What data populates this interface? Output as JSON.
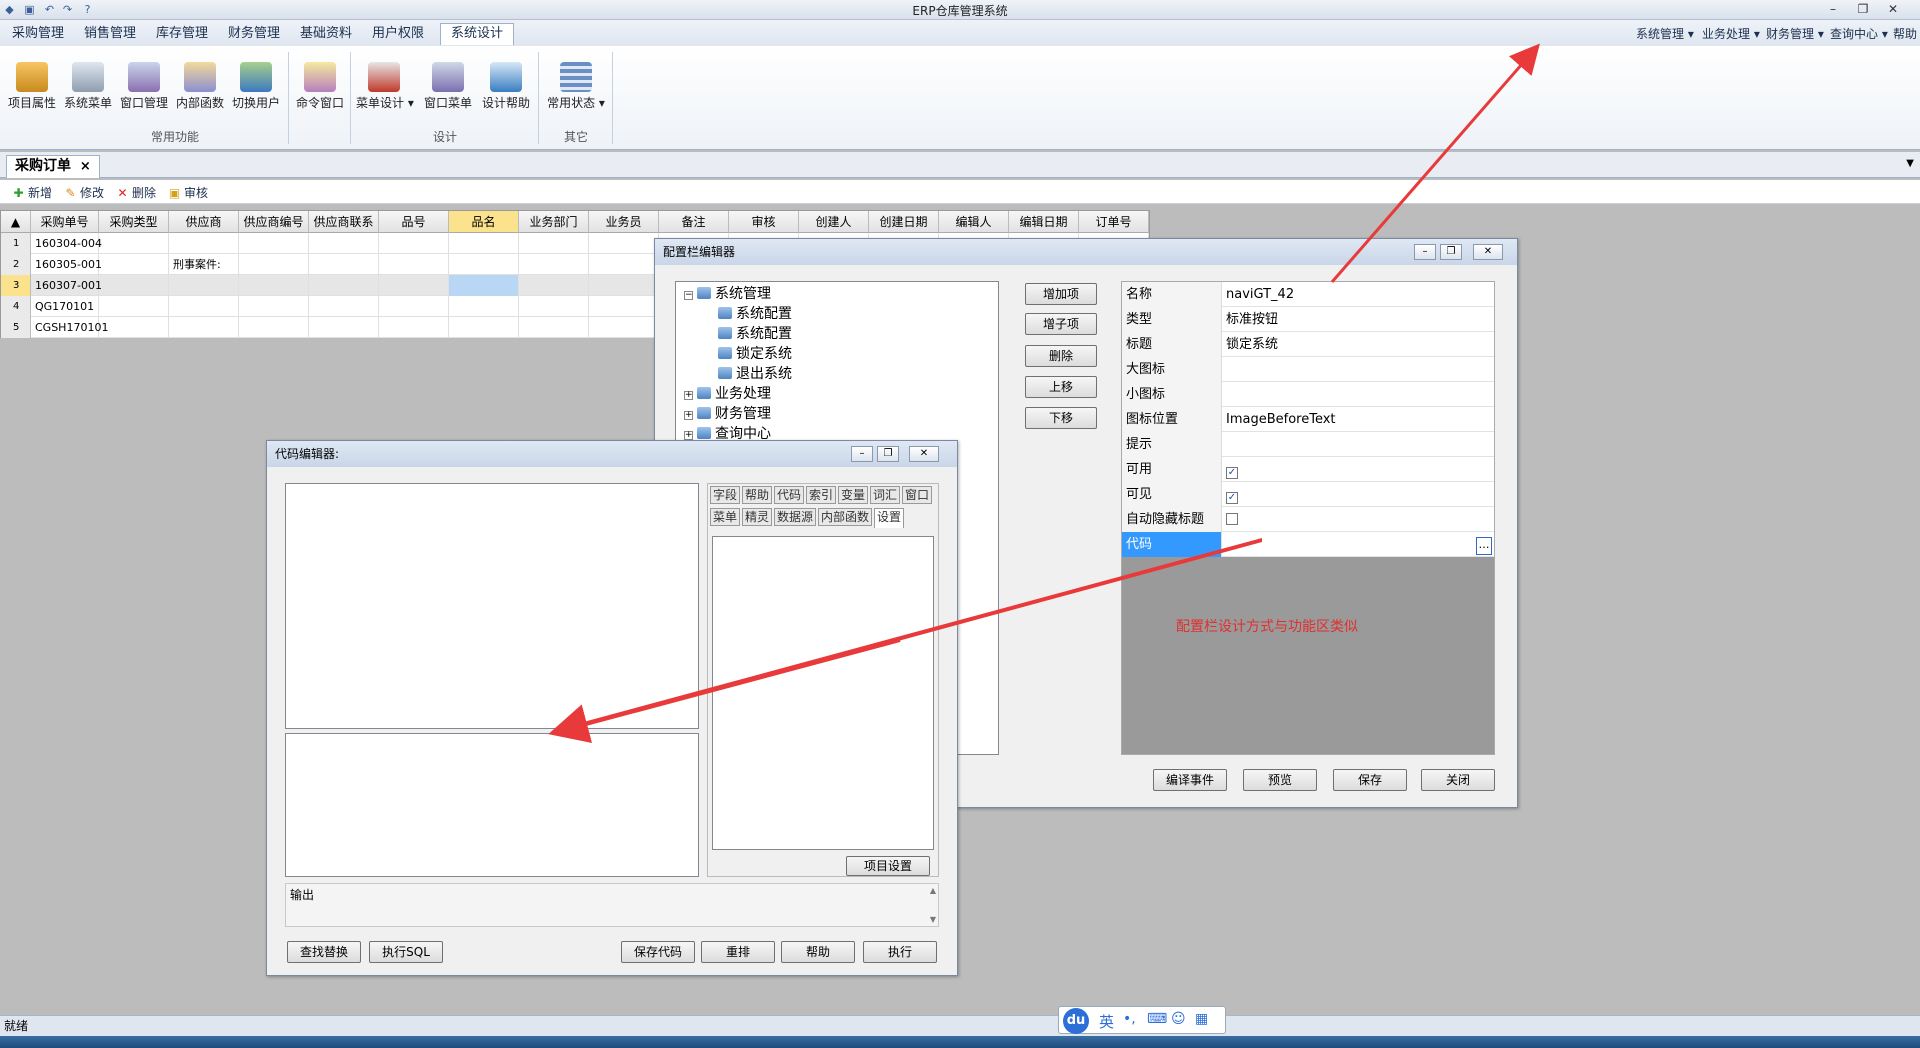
{
  "window": {
    "title": "ERP仓库管理系统"
  },
  "menu": {
    "tabs": [
      "采购管理",
      "销售管理",
      "库存管理",
      "财务管理",
      "基础资料",
      "用户权限",
      "系统设计"
    ],
    "active": "系统设计",
    "right": [
      "系统管理 ▾",
      "业务处理 ▾",
      "财务管理 ▾",
      "查询中心 ▾",
      "帮助"
    ]
  },
  "ribbon": {
    "buttons": [
      "项目属性",
      "系统菜单",
      "窗口管理",
      "内部函数",
      "切换用户",
      "命令窗口",
      "菜单设计 ▾",
      "窗口菜单",
      "设计帮助",
      "常用状态 ▾"
    ],
    "groups": [
      "常用功能",
      "设计",
      "其它"
    ]
  },
  "doc_tab": {
    "label": "采购订单",
    "close": "×"
  },
  "toolbar": {
    "new": "新增",
    "edit": "修改",
    "delete": "删除",
    "audit": "审核"
  },
  "grid": {
    "headers": [
      "采购单号",
      "采购类型",
      "供应商",
      "供应商编号",
      "供应商联系",
      "品号",
      "品名",
      "业务部门",
      "业务员",
      "备注",
      "审核",
      "创建人",
      "创建日期",
      "编辑人",
      "编辑日期",
      "订单号"
    ],
    "rows": [
      {
        "no": "1",
        "order": "160304-004",
        "extra": ""
      },
      {
        "no": "2",
        "order": "160305-001",
        "extra": "刑事案件:"
      },
      {
        "no": "3",
        "order": "160307-001",
        "extra": ""
      },
      {
        "no": "4",
        "order": "QG170101",
        "extra": ""
      },
      {
        "no": "5",
        "order": "CGSH170101",
        "extra": ""
      }
    ]
  },
  "config_dialog": {
    "title": "配置栏编辑器",
    "tree": [
      "系统管理",
      "系统配置",
      "系统配置",
      "锁定系统",
      "退出系统",
      "业务处理",
      "财务管理",
      "查询中心"
    ],
    "buttons": [
      "增加项",
      "增子项",
      "删除",
      "上移",
      "下移"
    ],
    "props": [
      {
        "k": "名称",
        "v": "naviGT_42"
      },
      {
        "k": "类型",
        "v": "标准按钮"
      },
      {
        "k": "标题",
        "v": "锁定系统"
      },
      {
        "k": "大图标",
        "v": ""
      },
      {
        "k": "小图标",
        "v": ""
      },
      {
        "k": "图标位置",
        "v": "ImageBeforeText"
      },
      {
        "k": "提示",
        "v": ""
      },
      {
        "k": "可用",
        "v": "✓"
      },
      {
        "k": "可见",
        "v": "✓"
      },
      {
        "k": "自动隐藏标题",
        "v": ""
      },
      {
        "k": "代码",
        "v": "…"
      }
    ],
    "annotation": "配置栏设计方式与功能区类似",
    "footer": [
      "编译事件",
      "预览",
      "保存",
      "关闭"
    ]
  },
  "code_dialog": {
    "title": "代码编辑器:",
    "tabs_row1": [
      "字段",
      "帮助",
      "代码",
      "索引",
      "变量",
      "词汇",
      "窗口"
    ],
    "tabs_row2": [
      "菜单",
      "精灵",
      "数据源",
      "内部函数",
      "设置"
    ],
    "project_settings": "项目设置",
    "output_label": "输出",
    "footer": [
      "查找替换",
      "执行SQL",
      "保存代码",
      "重排",
      "帮助",
      "执行"
    ]
  },
  "status": {
    "text": "就绪"
  },
  "ime": {
    "logo": "du",
    "lang": "英"
  },
  "colors": {
    "accent": "#3399ff",
    "annotation": "#e03030",
    "arrow": "#e83a3a"
  }
}
